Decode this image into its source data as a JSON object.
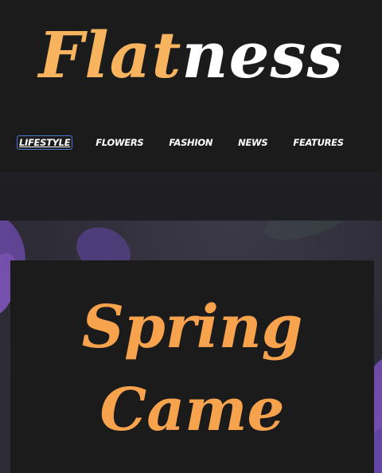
{
  "header": {
    "logo": {
      "part_a": "Flat",
      "part_b": "ness"
    },
    "nav": [
      {
        "label": "LIFESTYLE",
        "active": true
      },
      {
        "label": "FLOWERS"
      },
      {
        "label": "FASHION"
      },
      {
        "label": "NEWS"
      },
      {
        "label": "FEATURES"
      }
    ]
  },
  "hero": {
    "title_line1": "Spring",
    "title_line2": "Came"
  },
  "colors": {
    "background": "#1b1b1c",
    "logo_accent": "#f7b35e",
    "title_accent": "#f7a24d",
    "focus_outline": "#4a78d4"
  }
}
